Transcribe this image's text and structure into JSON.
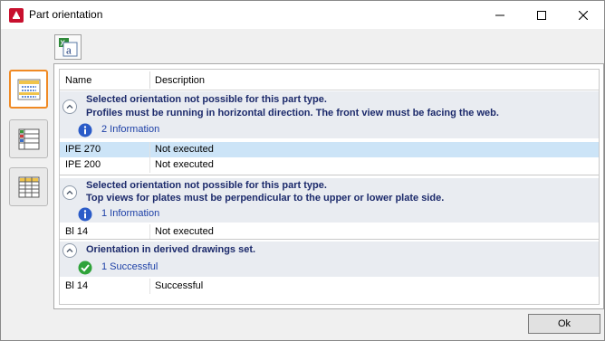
{
  "window": {
    "title": "Part orientation"
  },
  "grid": {
    "col_name": "Name",
    "col_description": "Description"
  },
  "groups": [
    {
      "line1": "Selected orientation not possible for this part type.",
      "line2": "Profiles must be running in horizontal direction. The front view must be facing the web.",
      "info_icon": "info-icon",
      "count_label": "2 Information",
      "rows": [
        {
          "name": "IPE 270",
          "description": "Not executed"
        },
        {
          "name": "IPE 200",
          "description": "Not executed"
        }
      ]
    },
    {
      "line1": "Selected orientation not possible for this part type.",
      "line2": "Top views for plates must be perpendicular to the upper or lower plate side.",
      "info_icon": "info-icon",
      "count_label": "1 Information",
      "rows": [
        {
          "name": "Bl 14",
          "description": "Not executed"
        }
      ]
    },
    {
      "line1": "Orientation in derived drawings set.",
      "info_icon": "success-check-icon",
      "count_label": "1 Successful",
      "rows": [
        {
          "name": "Bl 14",
          "description": "Successful"
        }
      ]
    }
  ],
  "ok_label": "Ok",
  "colors": {
    "accent": "#f08a24",
    "selection": "#cce4f7",
    "group_text": "#1c2a6b",
    "link": "#1c3fa6"
  }
}
